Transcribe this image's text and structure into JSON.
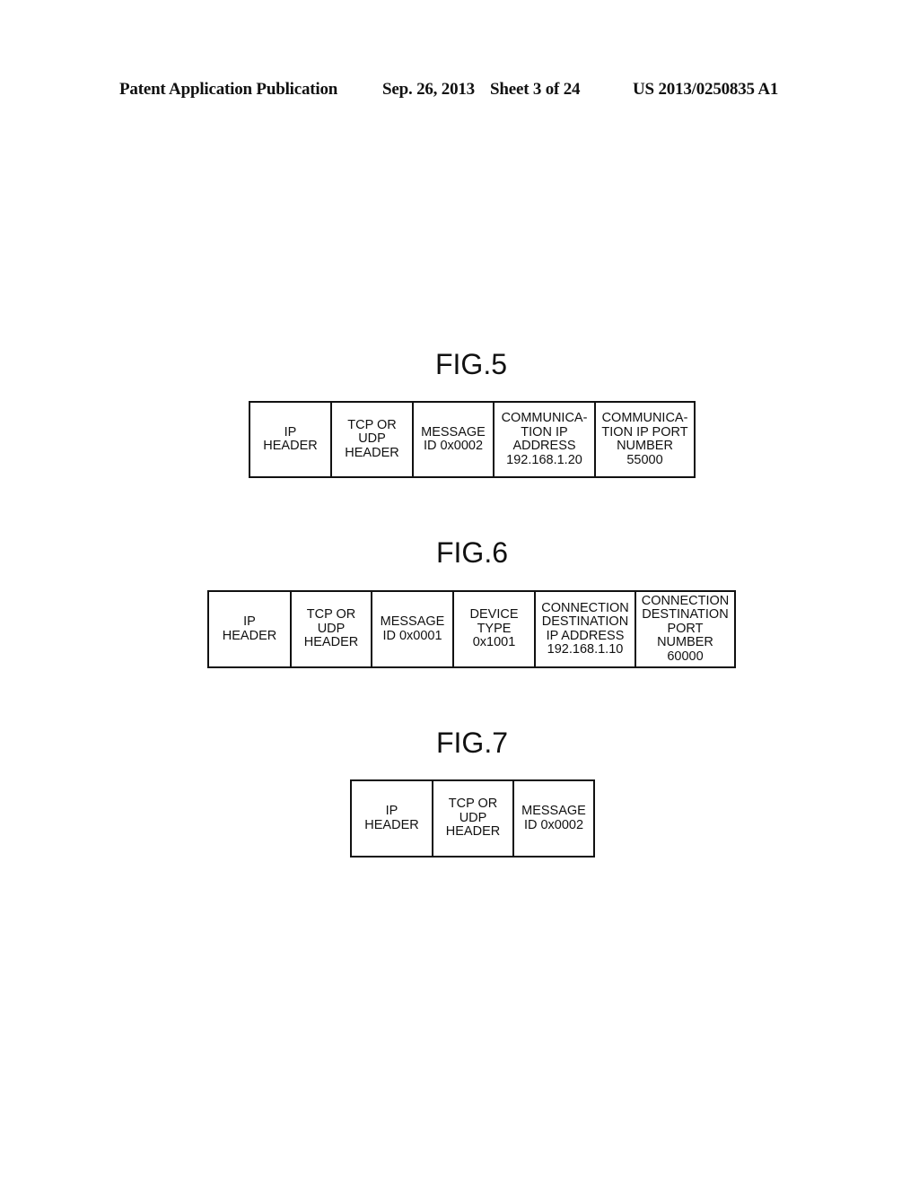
{
  "header": {
    "publication": "Patent Application Publication",
    "date": "Sep. 26, 2013",
    "sheet": "Sheet 3 of 24",
    "number": "US 2013/0250835 A1"
  },
  "figures": [
    {
      "title": "FIG.5",
      "fields": [
        "IP\nHEADER",
        "TCP OR\nUDP\nHEADER",
        "MESSAGE\nID 0x0002",
        "COMMUNICA-\nTION IP\nADDRESS\n192.168.1.20",
        "COMMUNICA-\nTION IP PORT\nNUMBER\n55000"
      ]
    },
    {
      "title": "FIG.6",
      "fields": [
        "IP\nHEADER",
        "TCP OR\nUDP\nHEADER",
        "MESSAGE\nID 0x0001",
        "DEVICE\nTYPE\n0x1001",
        "CONNECTION\nDESTINATION\nIP ADDRESS\n192.168.1.10",
        "CONNECTION\nDESTINATION\nPORT\nNUMBER\n60000"
      ]
    },
    {
      "title": "FIG.7",
      "fields": [
        "IP\nHEADER",
        "TCP OR\nUDP\nHEADER",
        "MESSAGE\nID 0x0002"
      ]
    }
  ]
}
